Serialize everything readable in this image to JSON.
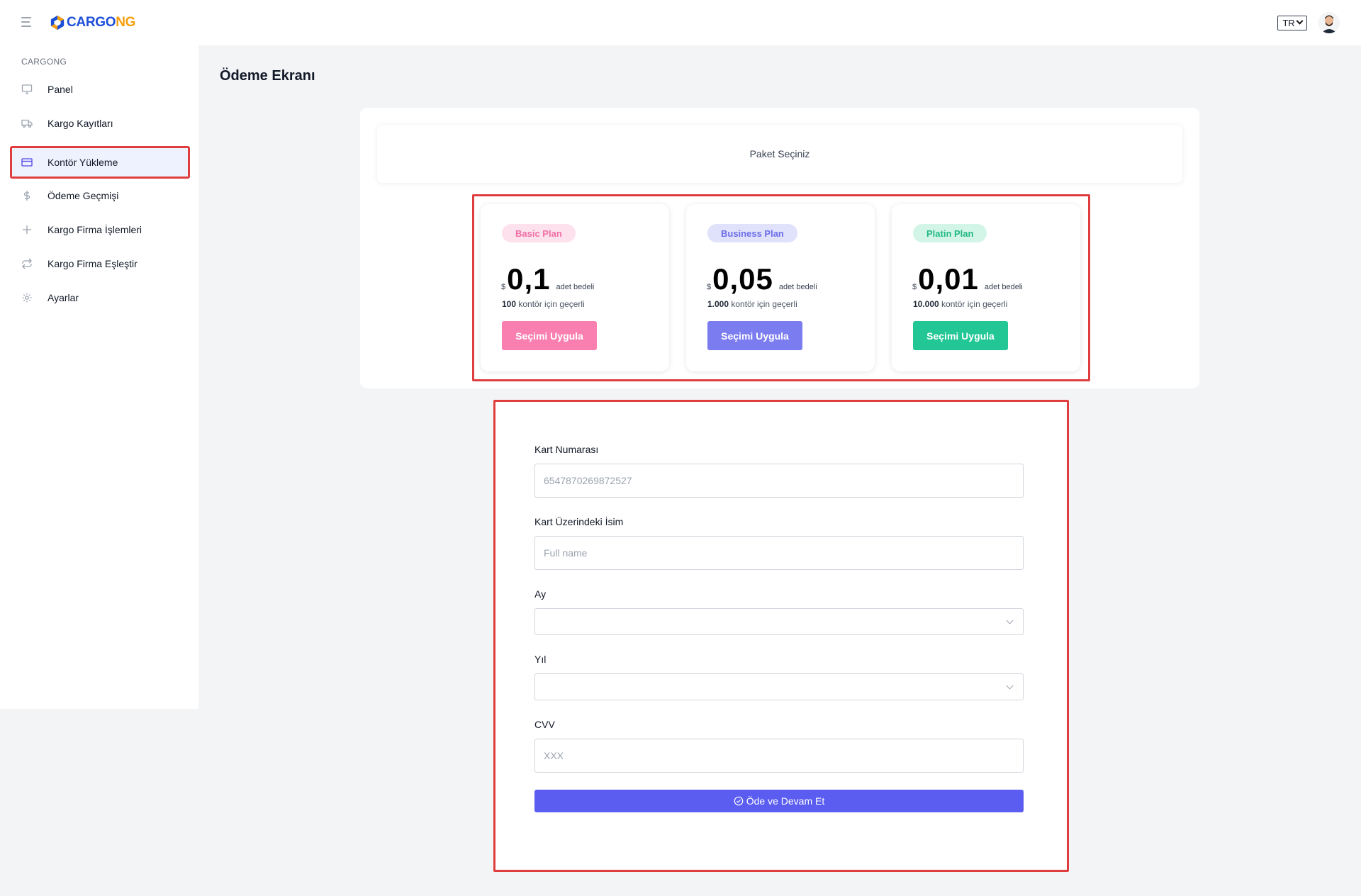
{
  "header": {
    "logo_text_a": "CARGO",
    "logo_text_b": "NG",
    "language": "TR"
  },
  "sidebar": {
    "heading": "CARGONG",
    "items": [
      {
        "label": "Panel",
        "icon": "monitor-icon"
      },
      {
        "label": "Kargo Kayıtları",
        "icon": "truck-icon"
      },
      {
        "label": "Kontör Yükleme",
        "icon": "credit-card-icon",
        "active": true
      },
      {
        "label": "Ödeme Geçmişi",
        "icon": "dollar-icon"
      },
      {
        "label": "Kargo Firma İşlemleri",
        "icon": "plus-icon"
      },
      {
        "label": "Kargo Firma Eşleştir",
        "icon": "repeat-icon"
      },
      {
        "label": "Ayarlar",
        "icon": "gear-icon"
      }
    ]
  },
  "main": {
    "title": "Ödeme Ekranı",
    "package_header": "Paket Seçiniz"
  },
  "plans": [
    {
      "name": "Basic Plan",
      "currency": "$",
      "price": "0,1",
      "unit": "adet bedeli",
      "credits": "100",
      "credits_suffix": "kontör için geçerli",
      "button": "Seçimi Uygula",
      "color": "#f87fb0",
      "badge_bg": "#fde2ee",
      "badge_color": "#f06ea5"
    },
    {
      "name": "Business Plan",
      "currency": "$",
      "price": "0,05",
      "unit": "adet bedeli",
      "credits": "1.000",
      "credits_suffix": "kontör için geçerli",
      "button": "Seçimi Uygula",
      "color": "#7b7cf0",
      "badge_bg": "#e0e1fb",
      "badge_color": "#6b6ee8"
    },
    {
      "name": "Platin Plan",
      "currency": "$",
      "price": "0,01",
      "unit": "adet bedeli",
      "credits": "10.000",
      "credits_suffix": "kontör için geçerli",
      "button": "Seçimi Uygula",
      "color": "#22c795",
      "badge_bg": "#d3f5e8",
      "badge_color": "#23b886"
    }
  ],
  "form": {
    "card_number_label": "Kart Numarası",
    "card_number_value": "6547870269872527",
    "card_name_label": "Kart Üzerindeki İsim",
    "card_name_placeholder": "Full name",
    "month_label": "Ay",
    "month_value": "",
    "year_label": "Yıl",
    "year_value": "",
    "cvv_label": "CVV",
    "cvv_placeholder": "XXX",
    "submit_label": "Öde ve Devam Et"
  },
  "colors": {
    "highlight": "#e03e3e",
    "accent": "#5b5df0"
  }
}
